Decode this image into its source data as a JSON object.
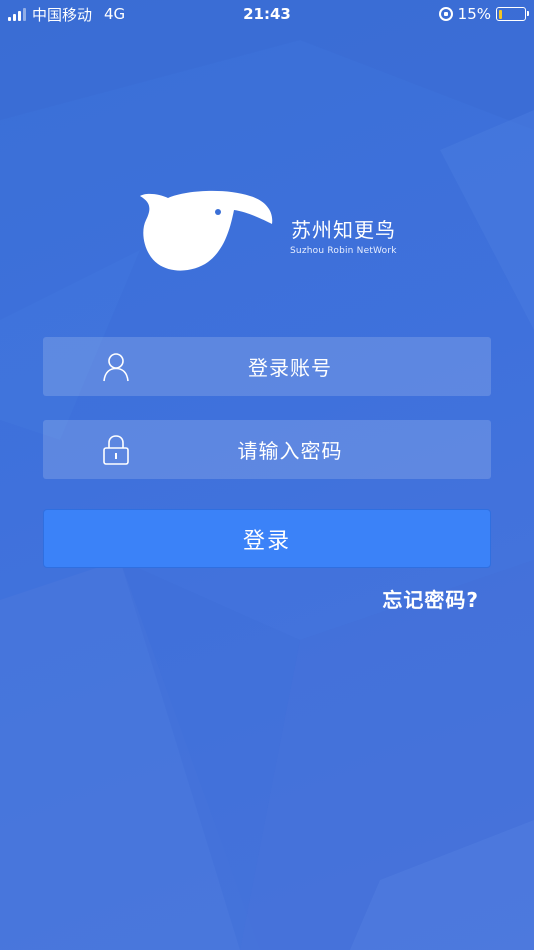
{
  "status_bar": {
    "carrier": "中国移动",
    "network": "4G",
    "time": "21:43",
    "battery": "15%",
    "battery_level": 0.15
  },
  "brand": {
    "name_cn": "苏州知更鸟",
    "name_en": "Suzhou Robin NetWork"
  },
  "form": {
    "account_placeholder": "登录账号",
    "password_placeholder": "请输入密码",
    "login_label": "登录",
    "forgot_label": "忘记密码?"
  },
  "colors": {
    "background": "#3b6fd8",
    "login_button": "#3b82f8",
    "battery": "#f5c623"
  }
}
